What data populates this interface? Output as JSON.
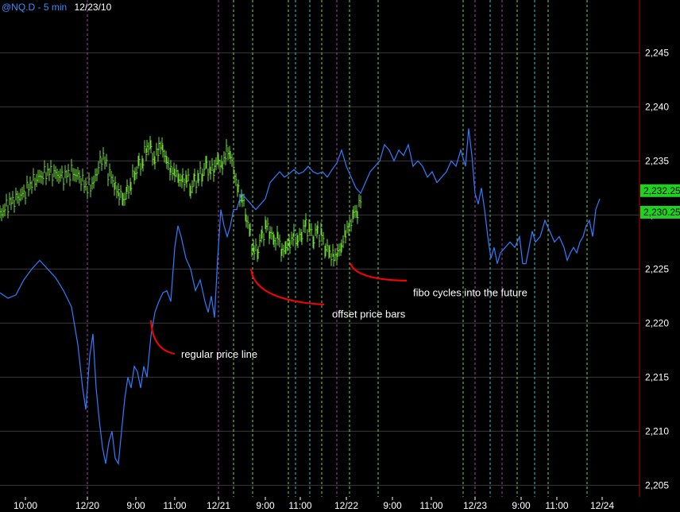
{
  "header": {
    "symbol_label": "@NQ.D - 5 min",
    "date_label": "12/23/10"
  },
  "colors": {
    "background": "#000000",
    "price_line": "#2f7dff",
    "offset_bars": "#6fdc3a",
    "price_label_bg": "#1fd21f",
    "annotation_curve": "#ff0000",
    "grid": "#3a3a3a",
    "axis_line": "#c00000",
    "axis_text": "#ffffff",
    "session_line": "#b03cb0",
    "fibo_green": "#7fd43a",
    "fibo_cyan": "#30c8d8"
  },
  "chart_data": {
    "type": "line",
    "title": "@NQ.D - 5 min",
    "ylim": [
      2203,
      2249
    ],
    "y_ticks": [
      2205,
      2210,
      2215,
      2220,
      2225,
      2230,
      2235,
      2240,
      2245
    ],
    "y_tick_labels": [
      "2,205",
      "2,210",
      "2,215",
      "2,220",
      "2,225",
      "2,230",
      "2,235",
      "2,240",
      "2,245"
    ],
    "x_tick_labels": [
      "10:00",
      "12/20",
      "9:00",
      "11:00",
      "12/21",
      "9:00",
      "11:00",
      "12/22",
      "9:00",
      "11:00",
      "12/23",
      "9:00",
      "11:00",
      "12/24"
    ],
    "x_tick_positions": [
      32,
      110,
      171,
      220,
      275,
      334,
      378,
      436,
      494,
      543,
      598,
      656,
      701,
      758
    ],
    "grid": true,
    "price_labels": [
      {
        "value": 2232.25,
        "text": "2,232.25"
      },
      {
        "value": 2230.25,
        "text": "2,230.25"
      }
    ],
    "series": [
      {
        "kind": "line",
        "points": [
          [
            0,
            2222.8
          ],
          [
            10,
            2222.3
          ],
          [
            20,
            2222.6
          ],
          [
            30,
            2224.0
          ],
          [
            40,
            2225.0
          ],
          [
            50,
            2225.8
          ],
          [
            60,
            2225.0
          ],
          [
            70,
            2224.2
          ],
          [
            80,
            2223.0
          ],
          [
            90,
            2221.5
          ],
          [
            98,
            2218.0
          ],
          [
            104,
            2214.0
          ],
          [
            108,
            2212.0
          ],
          [
            113,
            2217.0
          ],
          [
            117,
            2219.0
          ],
          [
            121,
            2214.0
          ],
          [
            125,
            2211.0
          ],
          [
            129,
            2208.5
          ],
          [
            133,
            2207.0
          ],
          [
            137,
            2209.0
          ],
          [
            141,
            2210.0
          ],
          [
            145,
            2207.5
          ],
          [
            149,
            2207.0
          ],
          [
            153,
            2210.0
          ],
          [
            157,
            2213.0
          ],
          [
            161,
            2215.0
          ],
          [
            165,
            2214.0
          ],
          [
            169,
            2216.0
          ],
          [
            173,
            2215.5
          ],
          [
            177,
            2214.0
          ],
          [
            181,
            2216.0
          ],
          [
            185,
            2215.0
          ],
          [
            190,
            2218.8
          ],
          [
            195,
            2221.0
          ],
          [
            200,
            2222.0
          ],
          [
            205,
            2222.8
          ],
          [
            210,
            2223.0
          ],
          [
            215,
            2222.0
          ],
          [
            220,
            2227.0
          ],
          [
            224,
            2229.0
          ],
          [
            228,
            2228.0
          ],
          [
            234,
            2226.0
          ],
          [
            240,
            2225.0
          ],
          [
            246,
            2223.0
          ],
          [
            252,
            2224.0
          ],
          [
            258,
            2222.0
          ],
          [
            262,
            2221.0
          ],
          [
            266,
            2222.5
          ],
          [
            270,
            2220.5
          ],
          [
            274,
            2226.0
          ],
          [
            278,
            2230.5
          ],
          [
            282,
            2229.0
          ],
          [
            286,
            2228.0
          ],
          [
            290,
            2229.0
          ],
          [
            294,
            2230.5
          ],
          [
            298,
            2230.5
          ],
          [
            304,
            2232.0
          ],
          [
            310,
            2231.5
          ],
          [
            316,
            2231.0
          ],
          [
            322,
            2230.5
          ],
          [
            328,
            2231.0
          ],
          [
            334,
            2231.5
          ],
          [
            340,
            2233.0
          ],
          [
            346,
            2233.5
          ],
          [
            352,
            2234.0
          ],
          [
            358,
            2233.5
          ],
          [
            364,
            2233.8
          ],
          [
            370,
            2234.2
          ],
          [
            376,
            2233.8
          ],
          [
            382,
            2234.0
          ],
          [
            388,
            2234.5
          ],
          [
            394,
            2234.0
          ],
          [
            400,
            2233.8
          ],
          [
            406,
            2234.0
          ],
          [
            412,
            2233.5
          ],
          [
            418,
            2234.2
          ],
          [
            424,
            2234.8
          ],
          [
            430,
            2236.0
          ],
          [
            436,
            2234.5
          ],
          [
            442,
            2233.5
          ],
          [
            448,
            2232.5
          ],
          [
            454,
            2232.0
          ],
          [
            460,
            2233.0
          ],
          [
            466,
            2234.0
          ],
          [
            472,
            2234.5
          ],
          [
            478,
            2235.0
          ],
          [
            484,
            2236.5
          ],
          [
            490,
            2236.0
          ],
          [
            496,
            2235.0
          ],
          [
            502,
            2236.0
          ],
          [
            508,
            2235.5
          ],
          [
            514,
            2236.5
          ],
          [
            520,
            2234.5
          ],
          [
            526,
            2235.0
          ],
          [
            532,
            2234.5
          ],
          [
            538,
            2233.5
          ],
          [
            544,
            2234.0
          ],
          [
            550,
            2233.0
          ],
          [
            556,
            2233.5
          ],
          [
            562,
            2234.0
          ],
          [
            568,
            2235.0
          ],
          [
            574,
            2234.5
          ],
          [
            580,
            2236.0
          ],
          [
            586,
            2234.5
          ],
          [
            590,
            2238.0
          ],
          [
            594,
            2235.5
          ],
          [
            598,
            2232.0
          ],
          [
            602,
            2231.0
          ],
          [
            606,
            2232.5
          ],
          [
            610,
            2230.5
          ],
          [
            614,
            2228.0
          ],
          [
            618,
            2226.0
          ],
          [
            622,
            2227.0
          ],
          [
            626,
            2225.5
          ],
          [
            630,
            2226.5
          ],
          [
            636,
            2227.0
          ],
          [
            642,
            2227.5
          ],
          [
            648,
            2227.0
          ],
          [
            654,
            2228.0
          ],
          [
            658,
            2225.5
          ],
          [
            662,
            2225.5
          ],
          [
            666,
            2227.0
          ],
          [
            670,
            2228.5
          ],
          [
            674,
            2227.5
          ],
          [
            680,
            2228.0
          ],
          [
            686,
            2229.5
          ],
          [
            692,
            2228.5
          ],
          [
            698,
            2227.5
          ],
          [
            704,
            2228.0
          ],
          [
            710,
            2227.0
          ],
          [
            714,
            2225.8
          ],
          [
            718,
            2226.5
          ],
          [
            722,
            2227.0
          ],
          [
            726,
            2226.5
          ],
          [
            730,
            2227.5
          ],
          [
            734,
            2228.0
          ],
          [
            738,
            2229.0
          ],
          [
            742,
            2229.5
          ],
          [
            746,
            2228.0
          ],
          [
            750,
            2230.5
          ],
          [
            755,
            2231.5
          ]
        ]
      },
      {
        "kind": "bars",
        "points": [
          [
            0,
            2230.0
          ],
          [
            10,
            2231.0
          ],
          [
            20,
            2231.5
          ],
          [
            30,
            2232.0
          ],
          [
            40,
            2233.0
          ],
          [
            50,
            2233.5
          ],
          [
            60,
            2234.0
          ],
          [
            70,
            2233.8
          ],
          [
            80,
            2233.5
          ],
          [
            90,
            2234.0
          ],
          [
            100,
            2233.5
          ],
          [
            110,
            2232.5
          ],
          [
            118,
            2233.0
          ],
          [
            124,
            2234.5
          ],
          [
            130,
            2235.5
          ],
          [
            136,
            2234.0
          ],
          [
            140,
            2233.5
          ],
          [
            145,
            2232.5
          ],
          [
            150,
            2232.0
          ],
          [
            155,
            2231.5
          ],
          [
            160,
            2232.0
          ],
          [
            165,
            2233.0
          ],
          [
            170,
            2234.0
          ],
          [
            175,
            2234.5
          ],
          [
            180,
            2235.0
          ],
          [
            185,
            2236.5
          ],
          [
            190,
            2236.0
          ],
          [
            195,
            2235.0
          ],
          [
            200,
            2236.5
          ],
          [
            205,
            2236.0
          ],
          [
            210,
            2235.0
          ],
          [
            215,
            2234.0
          ],
          [
            220,
            2234.0
          ],
          [
            225,
            2233.5
          ],
          [
            230,
            2233.0
          ],
          [
            235,
            2233.5
          ],
          [
            240,
            2232.5
          ],
          [
            245,
            2233.0
          ],
          [
            250,
            2233.5
          ],
          [
            255,
            2234.0
          ],
          [
            260,
            2234.5
          ],
          [
            265,
            2234.0
          ],
          [
            270,
            2234.5
          ],
          [
            275,
            2235.0
          ],
          [
            280,
            2234.5
          ],
          [
            285,
            2236.0
          ],
          [
            290,
            2235.5
          ],
          [
            295,
            2234.0
          ],
          [
            300,
            2232.0
          ],
          [
            305,
            2231.5
          ],
          [
            310,
            2230.0
          ],
          [
            315,
            2228.0
          ],
          [
            320,
            2226.5
          ],
          [
            325,
            2227.0
          ],
          [
            330,
            2228.0
          ],
          [
            335,
            2229.0
          ],
          [
            340,
            2228.5
          ],
          [
            345,
            2227.5
          ],
          [
            350,
            2228.0
          ],
          [
            355,
            2226.5
          ],
          [
            360,
            2227.0
          ],
          [
            365,
            2227.5
          ],
          [
            370,
            2228.0
          ],
          [
            375,
            2227.5
          ],
          [
            380,
            2228.5
          ],
          [
            385,
            2229.0
          ],
          [
            390,
            2228.5
          ],
          [
            395,
            2228.0
          ],
          [
            400,
            2228.5
          ],
          [
            405,
            2228.0
          ],
          [
            410,
            2227.0
          ],
          [
            415,
            2226.5
          ],
          [
            420,
            2226.0
          ],
          [
            425,
            2226.5
          ],
          [
            430,
            2227.0
          ],
          [
            435,
            2228.5
          ],
          [
            440,
            2229.0
          ],
          [
            445,
            2230.0
          ],
          [
            450,
            2230.5
          ],
          [
            455,
            2231.5
          ]
        ]
      }
    ],
    "annotations": [
      {
        "text": "regular price line",
        "x": 228,
        "y": 2216.8
      },
      {
        "text": "offset price bars",
        "x": 418,
        "y": 2220.5
      },
      {
        "text": "fibo cycles into the future",
        "x": 520,
        "y": 2222.5
      }
    ]
  }
}
